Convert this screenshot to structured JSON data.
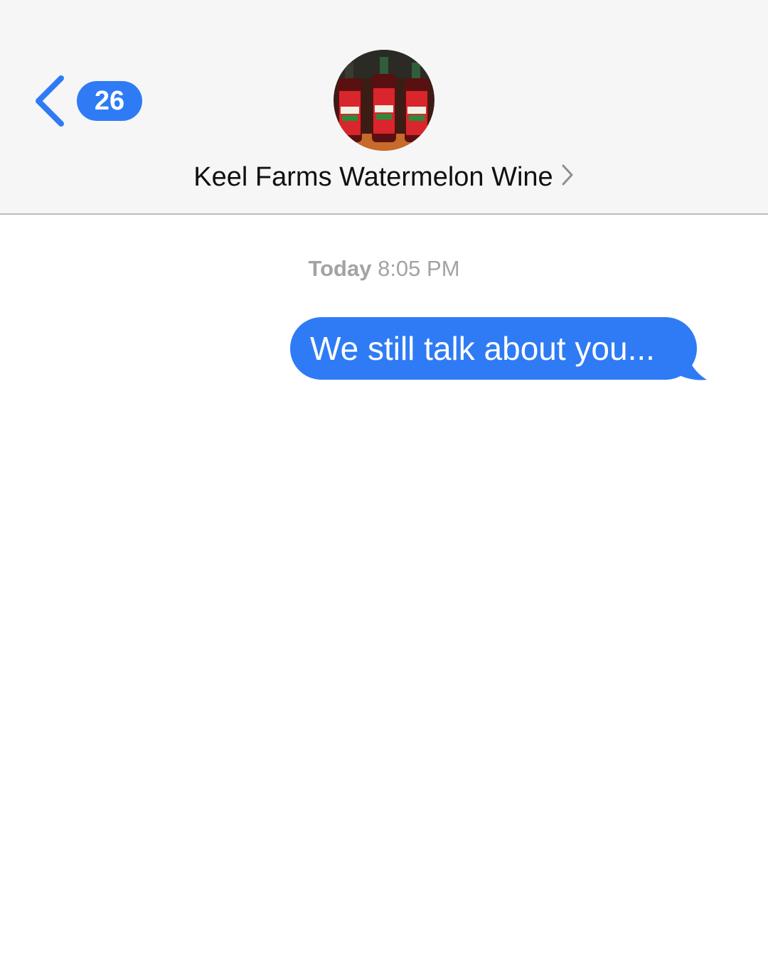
{
  "header": {
    "back_badge": "26",
    "contact_name": "Keel Farms Watermelon Wine"
  },
  "timestamp": {
    "day": "Today",
    "time": "8:05 PM"
  },
  "messages": [
    {
      "direction": "outgoing",
      "text": "We still talk about you..."
    }
  ],
  "colors": {
    "accent": "#2f7bf5",
    "header_bg": "#f6f6f6",
    "timestamp": "#a3a3a3"
  },
  "icons": {
    "back": "chevron-left-icon",
    "contact_details": "chevron-right-icon"
  }
}
